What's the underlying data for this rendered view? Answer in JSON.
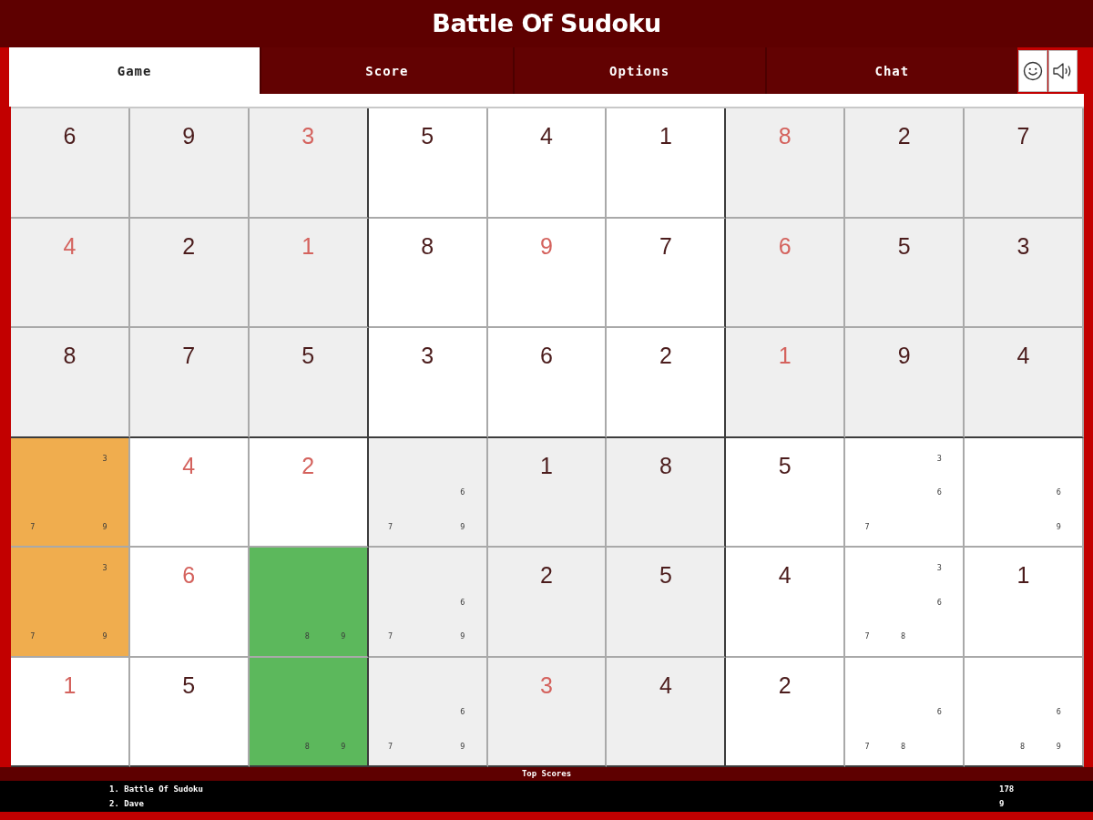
{
  "window": {
    "title": "Battle Of Sudoku"
  },
  "tabs": [
    {
      "label": "Game",
      "selected": true
    },
    {
      "label": "Score",
      "selected": false
    },
    {
      "label": "Options",
      "selected": false
    },
    {
      "label": "Chat",
      "selected": false
    }
  ],
  "board": {
    "rows": [
      {
        "cells": [
          {
            "kind": "given",
            "value": "6"
          },
          {
            "kind": "given",
            "value": "9"
          },
          {
            "kind": "entered",
            "value": "3"
          },
          {
            "kind": "given",
            "value": "5"
          },
          {
            "kind": "given",
            "value": "4"
          },
          {
            "kind": "given",
            "value": "1"
          },
          {
            "kind": "entered",
            "value": "8"
          },
          {
            "kind": "given",
            "value": "2"
          },
          {
            "kind": "given",
            "value": "7"
          }
        ]
      },
      {
        "cells": [
          {
            "kind": "entered",
            "value": "4"
          },
          {
            "kind": "given",
            "value": "2"
          },
          {
            "kind": "entered",
            "value": "1"
          },
          {
            "kind": "given",
            "value": "8"
          },
          {
            "kind": "entered",
            "value": "9"
          },
          {
            "kind": "given",
            "value": "7"
          },
          {
            "kind": "entered",
            "value": "6"
          },
          {
            "kind": "given",
            "value": "5"
          },
          {
            "kind": "given",
            "value": "3"
          }
        ]
      },
      {
        "cells": [
          {
            "kind": "given",
            "value": "8"
          },
          {
            "kind": "given",
            "value": "7"
          },
          {
            "kind": "given",
            "value": "5"
          },
          {
            "kind": "given",
            "value": "3"
          },
          {
            "kind": "given",
            "value": "6"
          },
          {
            "kind": "given",
            "value": "2"
          },
          {
            "kind": "entered",
            "value": "1"
          },
          {
            "kind": "given",
            "value": "9"
          },
          {
            "kind": "given",
            "value": "4"
          }
        ]
      },
      {
        "cells": [
          {
            "kind": "notes",
            "notes": [
              "3",
              "7",
              "9"
            ],
            "color": "#f0ad4e"
          },
          {
            "kind": "entered",
            "value": "4"
          },
          {
            "kind": "entered",
            "value": "2"
          },
          {
            "kind": "notes",
            "notes": [
              "6",
              "7",
              "9"
            ]
          },
          {
            "kind": "given",
            "value": "1"
          },
          {
            "kind": "given",
            "value": "8"
          },
          {
            "kind": "given",
            "value": "5"
          },
          {
            "kind": "notes",
            "notes": [
              "3",
              "6",
              "7"
            ]
          },
          {
            "kind": "notes",
            "notes": [
              "6",
              "9"
            ]
          }
        ]
      },
      {
        "cells": [
          {
            "kind": "notes",
            "notes": [
              "3",
              "7",
              "9"
            ],
            "color": "#f0ad4e"
          },
          {
            "kind": "entered",
            "value": "6"
          },
          {
            "kind": "notes",
            "notes": [
              "8",
              "9"
            ],
            "color": "#5cb85c"
          },
          {
            "kind": "notes",
            "notes": [
              "6",
              "7",
              "9"
            ]
          },
          {
            "kind": "given",
            "value": "2"
          },
          {
            "kind": "given",
            "value": "5"
          },
          {
            "kind": "given",
            "value": "4"
          },
          {
            "kind": "notes",
            "notes": [
              "3",
              "6",
              "7",
              "8"
            ]
          },
          {
            "kind": "given",
            "value": "1"
          }
        ]
      },
      {
        "cells": [
          {
            "kind": "entered",
            "value": "1"
          },
          {
            "kind": "given",
            "value": "5"
          },
          {
            "kind": "notes",
            "notes": [
              "8",
              "9"
            ],
            "color": "#5cb85c"
          },
          {
            "kind": "notes",
            "notes": [
              "6",
              "7",
              "9"
            ]
          },
          {
            "kind": "entered",
            "value": "3"
          },
          {
            "kind": "given",
            "value": "4"
          },
          {
            "kind": "given",
            "value": "2"
          },
          {
            "kind": "notes",
            "notes": [
              "6",
              "7",
              "8"
            ]
          },
          {
            "kind": "notes",
            "notes": [
              "6",
              "8",
              "9"
            ]
          }
        ]
      }
    ]
  },
  "top_scores": {
    "title": "Top Scores",
    "entries": [
      {
        "name": "1. Battle Of Sudoku",
        "score": "178"
      },
      {
        "name": "2. Dave",
        "score": "9"
      }
    ]
  }
}
